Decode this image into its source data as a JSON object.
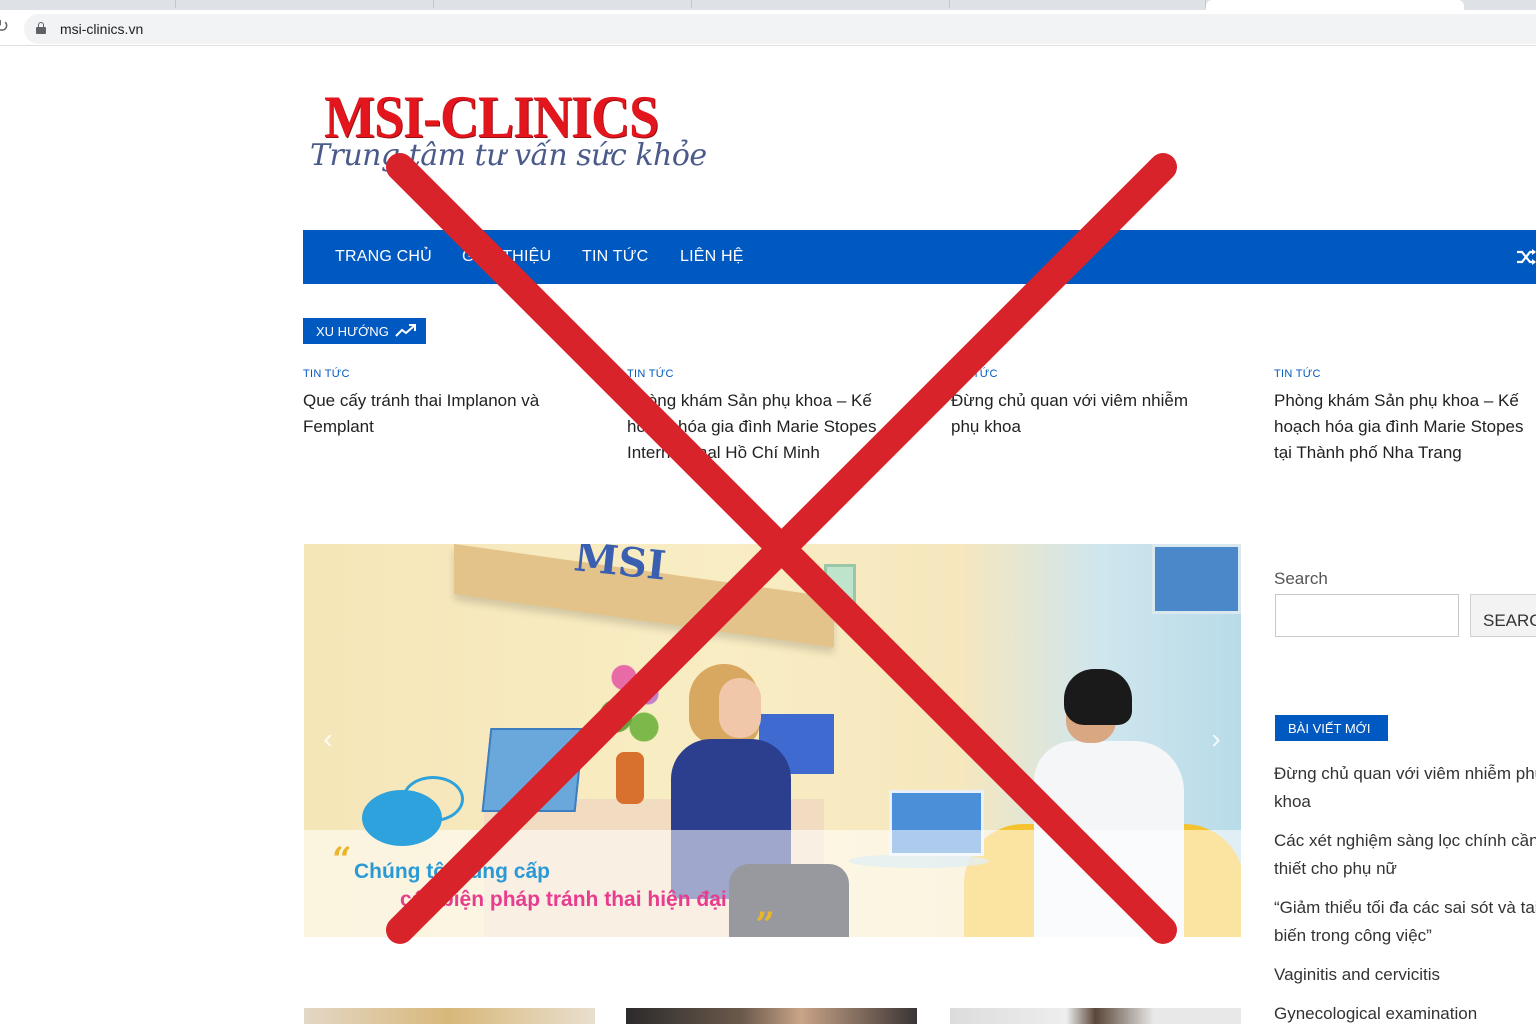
{
  "browser": {
    "url": "msi-clinics.vn"
  },
  "site": {
    "logo_main": "MSI-CLINICS",
    "logo_tagline": "Trung tâm tư vấn sức khỏe"
  },
  "nav": {
    "items": [
      {
        "label": "TRANG CHỦ"
      },
      {
        "label": "GIỚI THIỆU"
      },
      {
        "label": "TIN TỨC"
      },
      {
        "label": "LIÊN HỆ"
      }
    ],
    "shuffle_icon": "shuffle-icon",
    "bg_color": "#0059c1"
  },
  "trending": {
    "badge": "XU HƯỚNG",
    "badge_icon": "trending-up-icon",
    "items": [
      {
        "category": "TIN TỨC",
        "title": "Que cấy tránh thai Implanon và Femplant"
      },
      {
        "category": "TIN TỨC",
        "title": "Phòng khám Sản phụ khoa – Kế hoạch hóa gia đình Marie Stopes International Hồ Chí Minh"
      },
      {
        "category": "TIN TỨC",
        "title": "Đừng chủ quan với viêm nhiễm phụ khoa"
      },
      {
        "category": "TIN TỨC",
        "title": "Phòng khám Sản phụ khoa – Kế hoạch hóa gia đình Marie Stopes tại Thành phố Nha Trang"
      }
    ]
  },
  "slider": {
    "sign_text": "MSI",
    "caption_line1": "Chúng tôi cung cấp",
    "caption_line2": "các biện pháp tránh thai hiện đại",
    "quote_open": "“",
    "quote_close": "„",
    "prev_arrow": "‹",
    "next_arrow": "›"
  },
  "sidebar": {
    "search_label": "Search",
    "search_placeholder": "",
    "search_button": "SEARCH",
    "recent_badge": "BÀI VIẾT MỚI",
    "recent_posts": [
      {
        "title": "Đừng chủ quan với viêm nhiễm phụ khoa"
      },
      {
        "title": "Các xét nghiệm sàng lọc chính cần thiết cho phụ nữ"
      },
      {
        "title": "“Giảm thiểu tối đa các sai sót và tai biến trong công việc”"
      },
      {
        "title": "Vaginitis and cervicitis"
      },
      {
        "title": "Gynecological examination"
      }
    ]
  },
  "overlay": {
    "type": "red-x-mark",
    "color": "#d9232b"
  }
}
